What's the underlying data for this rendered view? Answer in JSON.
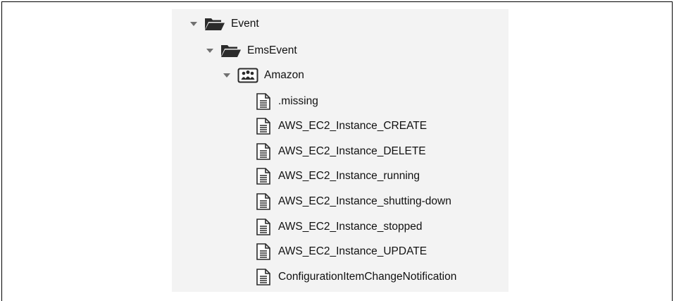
{
  "tree": {
    "root": {
      "label": "Event",
      "icon": "folder-open-icon",
      "expanded": true
    },
    "child": {
      "label": "EmsEvent",
      "icon": "folder-open-icon",
      "expanded": true
    },
    "namespace": {
      "label": "Amazon",
      "icon": "namespace-people-icon",
      "expanded": true
    },
    "items": [
      {
        "label": ".missing",
        "icon": "document-icon"
      },
      {
        "label": "AWS_EC2_Instance_CREATE",
        "icon": "document-icon"
      },
      {
        "label": "AWS_EC2_Instance_DELETE",
        "icon": "document-icon"
      },
      {
        "label": "AWS_EC2_Instance_running",
        "icon": "document-icon"
      },
      {
        "label": "AWS_EC2_Instance_shutting-down",
        "icon": "document-icon"
      },
      {
        "label": "AWS_EC2_Instance_stopped",
        "icon": "document-icon"
      },
      {
        "label": "AWS_EC2_Instance_UPDATE",
        "icon": "document-icon"
      },
      {
        "label": "ConfigurationItemChangeNotification",
        "icon": "document-icon"
      }
    ]
  }
}
